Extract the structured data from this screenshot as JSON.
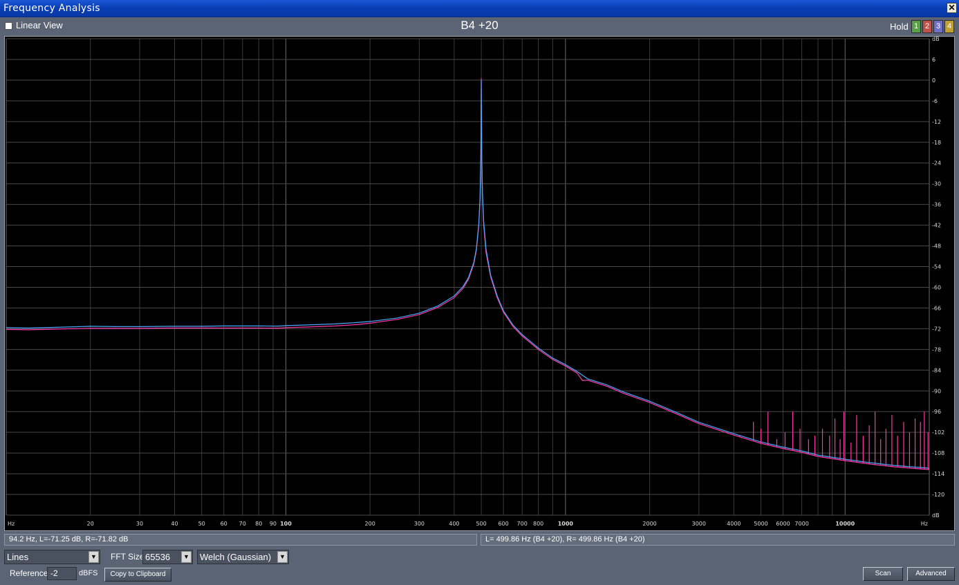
{
  "window": {
    "title": "Frequency Analysis",
    "close_glyph": "✕"
  },
  "toolbar": {
    "linear_view_label": "Linear View",
    "linear_view_checked": false,
    "note_display": "B4 +20",
    "hold_label": "Hold",
    "hold_buttons": [
      {
        "label": "1",
        "color": "#5aa04a"
      },
      {
        "label": "2",
        "color": "#c0504a"
      },
      {
        "label": "3",
        "color": "#7070c8"
      },
      {
        "label": "4",
        "color": "#c0a030"
      }
    ]
  },
  "chart_data": {
    "type": "line",
    "x_scale": "log",
    "xlim": [
      10,
      20000
    ],
    "ylim": [
      -126,
      12
    ],
    "xlabel": "Hz",
    "ylabel": "dB",
    "x_ticks": [
      {
        "value": 10,
        "label": "Hz"
      },
      {
        "value": 20,
        "label": "20"
      },
      {
        "value": 30,
        "label": "30"
      },
      {
        "value": 40,
        "label": "40"
      },
      {
        "value": 50,
        "label": "50"
      },
      {
        "value": 60,
        "label": "60"
      },
      {
        "value": 70,
        "label": "70"
      },
      {
        "value": 80,
        "label": "80"
      },
      {
        "value": 90,
        "label": "90"
      },
      {
        "value": 100,
        "label": "100"
      },
      {
        "value": 200,
        "label": "200"
      },
      {
        "value": 300,
        "label": "300"
      },
      {
        "value": 400,
        "label": "400"
      },
      {
        "value": 500,
        "label": "500"
      },
      {
        "value": 600,
        "label": "600"
      },
      {
        "value": 700,
        "label": "700"
      },
      {
        "value": 800,
        "label": "800"
      },
      {
        "value": 1000,
        "label": "1000"
      },
      {
        "value": 2000,
        "label": "2000"
      },
      {
        "value": 3000,
        "label": "3000"
      },
      {
        "value": 4000,
        "label": "4000"
      },
      {
        "value": 5000,
        "label": "5000"
      },
      {
        "value": 6000,
        "label": "6000"
      },
      {
        "value": 7000,
        "label": "7000"
      },
      {
        "value": 10000,
        "label": "10000"
      },
      {
        "value": 20000,
        "label": "Hz"
      }
    ],
    "y_ticks": [
      {
        "value": 12,
        "label": "dB"
      },
      {
        "value": 6,
        "label": "6"
      },
      {
        "value": 0,
        "label": "0"
      },
      {
        "value": -6,
        "label": "-6"
      },
      {
        "value": -12,
        "label": "-12"
      },
      {
        "value": -18,
        "label": "-18"
      },
      {
        "value": -24,
        "label": "-24"
      },
      {
        "value": -30,
        "label": "-30"
      },
      {
        "value": -36,
        "label": "-36"
      },
      {
        "value": -42,
        "label": "-42"
      },
      {
        "value": -48,
        "label": "-48"
      },
      {
        "value": -54,
        "label": "-54"
      },
      {
        "value": -60,
        "label": "-60"
      },
      {
        "value": -66,
        "label": "-66"
      },
      {
        "value": -72,
        "label": "-72"
      },
      {
        "value": -78,
        "label": "-78"
      },
      {
        "value": -84,
        "label": "-84"
      },
      {
        "value": -90,
        "label": "-90"
      },
      {
        "value": -96,
        "label": "-96"
      },
      {
        "value": -102,
        "label": "-102"
      },
      {
        "value": -108,
        "label": "-108"
      },
      {
        "value": -114,
        "label": "-114"
      },
      {
        "value": -120,
        "label": "-120"
      },
      {
        "value": -126,
        "label": "dB"
      }
    ],
    "grid": true,
    "series": [
      {
        "channel": "L",
        "color": "#4aa8ff",
        "points": [
          [
            10,
            -71.7
          ],
          [
            12,
            -71.8
          ],
          [
            15,
            -71.6
          ],
          [
            20,
            -71.3
          ],
          [
            25,
            -71.4
          ],
          [
            30,
            -71.4
          ],
          [
            40,
            -71.3
          ],
          [
            50,
            -71.3
          ],
          [
            60,
            -71.2
          ],
          [
            70,
            -71.2
          ],
          [
            80,
            -71.2
          ],
          [
            94.2,
            -71.25
          ],
          [
            100,
            -71.1
          ],
          [
            120,
            -70.9
          ],
          [
            150,
            -70.6
          ],
          [
            180,
            -70.2
          ],
          [
            200,
            -69.9
          ],
          [
            250,
            -68.9
          ],
          [
            300,
            -67.5
          ],
          [
            350,
            -65.4
          ],
          [
            400,
            -62.5
          ],
          [
            430,
            -59.8
          ],
          [
            450,
            -57.2
          ],
          [
            470,
            -52.8
          ],
          [
            480,
            -48.9
          ],
          [
            490,
            -41.5
          ],
          [
            495,
            -33.5
          ],
          [
            498,
            -22
          ],
          [
            499,
            -12
          ],
          [
            499.86,
            0
          ],
          [
            501,
            -12
          ],
          [
            502,
            -22
          ],
          [
            505,
            -33
          ],
          [
            510,
            -41
          ],
          [
            520,
            -49
          ],
          [
            540,
            -56.5
          ],
          [
            570,
            -62.5
          ],
          [
            600,
            -66.8
          ],
          [
            650,
            -71
          ],
          [
            700,
            -73.7
          ],
          [
            800,
            -77.6
          ],
          [
            900,
            -80.5
          ],
          [
            1000,
            -82.4
          ],
          [
            1100,
            -84.4
          ],
          [
            1200,
            -86.5
          ],
          [
            1400,
            -88.2
          ],
          [
            1600,
            -90.2
          ],
          [
            2000,
            -93
          ],
          [
            2500,
            -96.3
          ],
          [
            3000,
            -99.1
          ],
          [
            4000,
            -102.4
          ],
          [
            5000,
            -104.8
          ],
          [
            6000,
            -106.3
          ],
          [
            7000,
            -107.4
          ],
          [
            8000,
            -108.6
          ],
          [
            10000,
            -109.8
          ],
          [
            12000,
            -110.7
          ],
          [
            15000,
            -111.6
          ],
          [
            20000,
            -112.4
          ]
        ]
      },
      {
        "channel": "R",
        "color": "#ff3aa8",
        "points": [
          [
            10,
            -72.2
          ],
          [
            12,
            -72.3
          ],
          [
            15,
            -72.1
          ],
          [
            20,
            -71.9
          ],
          [
            25,
            -71.9
          ],
          [
            30,
            -71.9
          ],
          [
            40,
            -71.8
          ],
          [
            50,
            -71.8
          ],
          [
            60,
            -71.8
          ],
          [
            70,
            -71.8
          ],
          [
            80,
            -71.8
          ],
          [
            94.2,
            -71.82
          ],
          [
            100,
            -71.7
          ],
          [
            120,
            -71.5
          ],
          [
            150,
            -71.2
          ],
          [
            180,
            -70.8
          ],
          [
            200,
            -70.4
          ],
          [
            250,
            -69.3
          ],
          [
            300,
            -67.9
          ],
          [
            350,
            -65.8
          ],
          [
            400,
            -63
          ],
          [
            430,
            -60.3
          ],
          [
            450,
            -57.7
          ],
          [
            470,
            -53.3
          ],
          [
            480,
            -49.4
          ],
          [
            490,
            -42
          ],
          [
            495,
            -34
          ],
          [
            498,
            -23
          ],
          [
            499,
            -13
          ],
          [
            499.86,
            0.5
          ],
          [
            501,
            -13
          ],
          [
            502,
            -23
          ],
          [
            505,
            -34
          ],
          [
            510,
            -42
          ],
          [
            520,
            -50
          ],
          [
            540,
            -57
          ],
          [
            570,
            -63
          ],
          [
            600,
            -67.2
          ],
          [
            650,
            -71.4
          ],
          [
            700,
            -74.1
          ],
          [
            800,
            -78
          ],
          [
            900,
            -80.9
          ],
          [
            1000,
            -82.8
          ],
          [
            1100,
            -84.8
          ],
          [
            1150,
            -87
          ],
          [
            1200,
            -86.9
          ],
          [
            1400,
            -88.6
          ],
          [
            1600,
            -90.6
          ],
          [
            2000,
            -93.4
          ],
          [
            2500,
            -96.7
          ],
          [
            3000,
            -99.5
          ],
          [
            4000,
            -102.8
          ],
          [
            5000,
            -105.2
          ],
          [
            6000,
            -106.7
          ],
          [
            7000,
            -107.8
          ],
          [
            8000,
            -109
          ],
          [
            10000,
            -110.2
          ],
          [
            12000,
            -111.1
          ],
          [
            15000,
            -112
          ],
          [
            20000,
            -112.8
          ]
        ],
        "spikes": [
          [
            4200,
            -103
          ],
          [
            4700,
            -99
          ],
          [
            5000,
            -101
          ],
          [
            5300,
            -96
          ],
          [
            5700,
            -104
          ],
          [
            6100,
            -102
          ],
          [
            6500,
            -96
          ],
          [
            6900,
            -101
          ],
          [
            7400,
            -104
          ],
          [
            7800,
            -103
          ],
          [
            8300,
            -101
          ],
          [
            8800,
            -103
          ],
          [
            9200,
            -98
          ],
          [
            9600,
            -104
          ],
          [
            9900,
            -96
          ],
          [
            10500,
            -105
          ],
          [
            11000,
            -97
          ],
          [
            11600,
            -103
          ],
          [
            12200,
            -100
          ],
          [
            12800,
            -96
          ],
          [
            13400,
            -104
          ],
          [
            14000,
            -101
          ],
          [
            14700,
            -97
          ],
          [
            15400,
            -103
          ],
          [
            16200,
            -99
          ],
          [
            17000,
            -102
          ],
          [
            17800,
            -98
          ],
          [
            18600,
            -99
          ],
          [
            19200,
            -96
          ],
          [
            19800,
            -102
          ]
        ]
      }
    ]
  },
  "status": {
    "cursor_readout": "94.2 Hz, L=-71.25 dB, R=-71.82 dB",
    "peak_readout": "L= 499.86 Hz (B4 +20), R= 499.86 Hz (B4 +20)"
  },
  "controls": {
    "graph_mode": "Lines",
    "fft_size_label": "FFT Size",
    "fft_size": "65536",
    "window_function": "Welch (Gaussian)",
    "reference_label": "Reference",
    "reference_value": "-2",
    "reference_unit": "dBFS",
    "copy_button": "Copy to Clipboard",
    "scan_button": "Scan",
    "advanced_button": "Advanced",
    "dropdown_arrow": "▼"
  }
}
